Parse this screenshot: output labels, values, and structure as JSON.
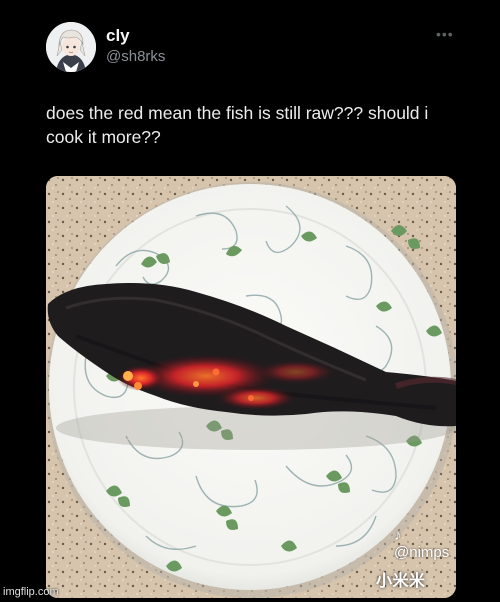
{
  "user": {
    "display_name": "cly",
    "handle": "@sh8rks"
  },
  "post": {
    "more_icon": "more-options-icon",
    "text": "does the red mean the fish is still raw??? should i cook it more??"
  },
  "media": {
    "subject": "photo",
    "watermark_platform_icon": "tiktok-icon",
    "watermark_handle": "@nimps",
    "watermark_user": "小米米"
  },
  "footer": {
    "credit": "imgflip.com"
  }
}
